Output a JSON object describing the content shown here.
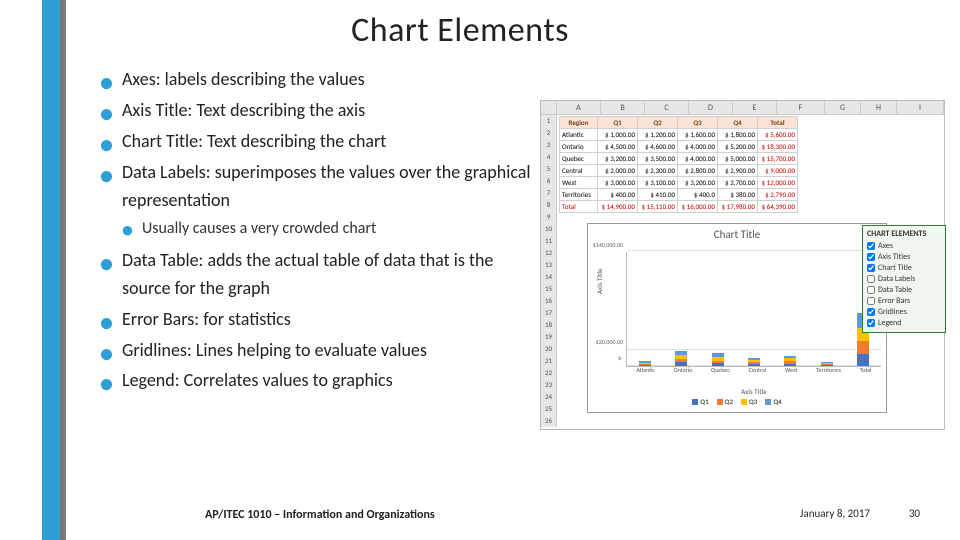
{
  "title": "Chart Elements",
  "bullets": [
    "Axes: labels describing the values",
    "Axis Title: Text describing the axis",
    "Chart Title: Text describing the chart",
    "Data Labels: superimposes the values over the graphical representation",
    "Data Table: adds the actual table of data that is the source for the graph",
    "Error Bars: for statistics",
    "Gridlines: Lines helping to evaluate values",
    "Legend: Correlates values to graphics"
  ],
  "subbullet": "Usually causes a very crowded chart",
  "footer": {
    "course": "AP/ITEC 1010 – Information and Organizations",
    "date": "January 8, 2017",
    "page": "30"
  },
  "excel": {
    "columns": [
      "A",
      "B",
      "C",
      "D",
      "E",
      "F",
      "G",
      "H",
      "I"
    ],
    "row_count": 26,
    "table": {
      "headers": [
        "Region",
        "Q1",
        "Q2",
        "Q3",
        "Q4",
        "Total"
      ],
      "rows": [
        [
          "Atlantic",
          "$ 1,000.00",
          "$ 1,200.00",
          "$ 1,600.00",
          "$ 1,800.00",
          "$ 5,600.00"
        ],
        [
          "Ontario",
          "$ 4,500.00",
          "$ 4,600.00",
          "$ 4,000.00",
          "$ 5,200.00",
          "$ 18,300.00"
        ],
        [
          "Quebec",
          "$ 3,200.00",
          "$ 3,500.00",
          "$ 4,000.00",
          "$ 5,000.00",
          "$ 15,700.00"
        ],
        [
          "Central",
          "$ 2,000.00",
          "$ 2,300.00",
          "$ 2,800.00",
          "$ 2,900.00",
          "$ 9,000.00"
        ],
        [
          "West",
          "$ 3,000.00",
          "$ 3,100.00",
          "$ 3,200.00",
          "$ 2,700.00",
          "$ 12,000.00"
        ],
        [
          "Territories",
          "$ 400.00",
          "$ 410.00",
          "$ 400.0",
          "$ 380.00",
          "$ 2,790.00"
        ]
      ],
      "total_row": [
        "Total",
        "$ 14,900.00",
        "$ 15,110.00",
        "$ 16,000.00",
        "$ 17,980.00",
        "$ 64,390.00"
      ]
    },
    "chart": {
      "title": "Chart Title",
      "ylabel": "Axis Title",
      "xlabel": "Axis Title",
      "legend": [
        "Q1",
        "Q2",
        "Q3",
        "Q4"
      ],
      "yticks": [
        "$-",
        "$20,000.00",
        "$140,000.00"
      ]
    },
    "elements_panel": {
      "title": "CHART ELEMENTS",
      "items": [
        {
          "label": "Axes",
          "checked": true
        },
        {
          "label": "Axis Titles",
          "checked": true
        },
        {
          "label": "Chart Title",
          "checked": true
        },
        {
          "label": "Data Labels",
          "checked": false
        },
        {
          "label": "Data Table",
          "checked": false
        },
        {
          "label": "Error Bars",
          "checked": false
        },
        {
          "label": "Gridlines",
          "checked": true
        },
        {
          "label": "Legend",
          "checked": true
        }
      ]
    }
  },
  "chart_data": {
    "type": "bar",
    "title": "Chart Title",
    "xlabel": "Axis Title",
    "ylabel": "Axis Title",
    "categories": [
      "Atlantic",
      "Ontario",
      "Quebec",
      "Central",
      "West",
      "Territories",
      "Total"
    ],
    "series": [
      {
        "name": "Q1",
        "values": [
          1000,
          4500,
          3200,
          2000,
          3000,
          400,
          14900
        ]
      },
      {
        "name": "Q2",
        "values": [
          1200,
          4600,
          3500,
          2300,
          3100,
          410,
          15110
        ]
      },
      {
        "name": "Q3",
        "values": [
          1600,
          4000,
          4000,
          2800,
          3200,
          400,
          16000
        ]
      },
      {
        "name": "Q4",
        "values": [
          1800,
          5200,
          5000,
          2900,
          2700,
          380,
          17980
        ]
      }
    ],
    "ylim": [
      0,
      140000
    ],
    "stacked": true
  }
}
